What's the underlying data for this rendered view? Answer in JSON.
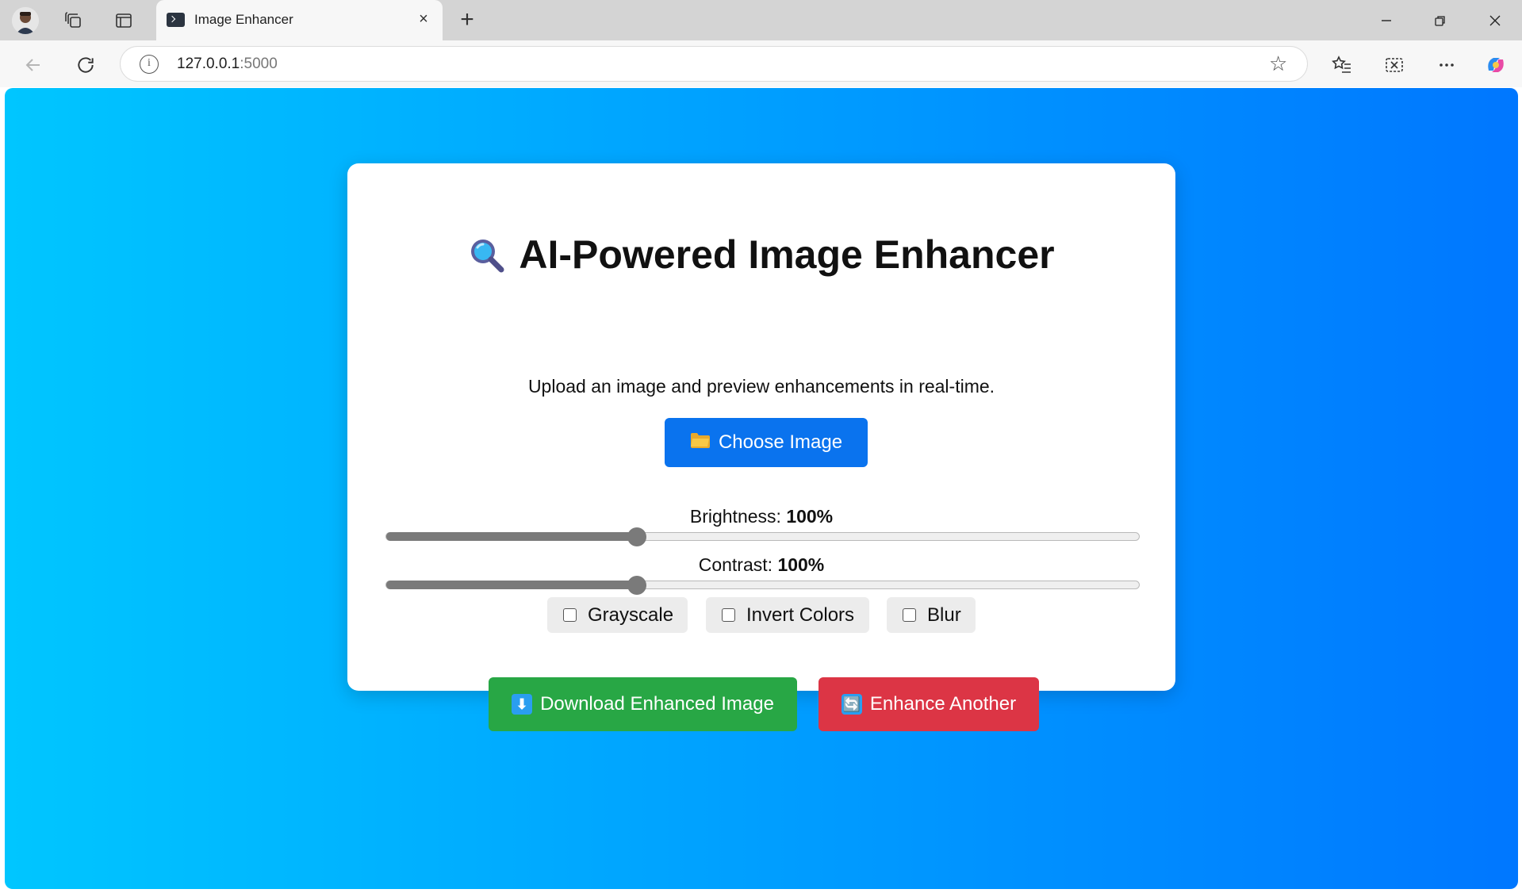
{
  "browser": {
    "tab_title": "Image Enhancer",
    "url_host": "127.0.0.1",
    "url_port": ":5000"
  },
  "page": {
    "title": "AI-Powered Image Enhancer",
    "subtitle": "Upload an image and preview enhancements in real-time.",
    "choose_button": "Choose Image",
    "brightness": {
      "label": "Brightness:",
      "value_text": "100%",
      "value": 100,
      "max": 300
    },
    "contrast": {
      "label": "Contrast:",
      "value_text": "100%",
      "value": 100,
      "max": 300
    },
    "filters": [
      {
        "label": "Grayscale",
        "checked": false
      },
      {
        "label": "Invert Colors",
        "checked": false
      },
      {
        "label": "Blur",
        "checked": false
      }
    ],
    "download_button": "Download Enhanced Image",
    "another_button": "Enhance Another"
  },
  "icons": {
    "title_icon": "magnifying-glass-icon",
    "choose_icon": "folder-icon",
    "download_icon": "down-arrow-icon",
    "another_icon": "refresh-icon"
  },
  "colors": {
    "gradient_start": "#00c6ff",
    "gradient_end": "#0077ff",
    "choose_button": "#0a73ee",
    "download_button": "#28a745",
    "another_button": "#dc3545"
  }
}
